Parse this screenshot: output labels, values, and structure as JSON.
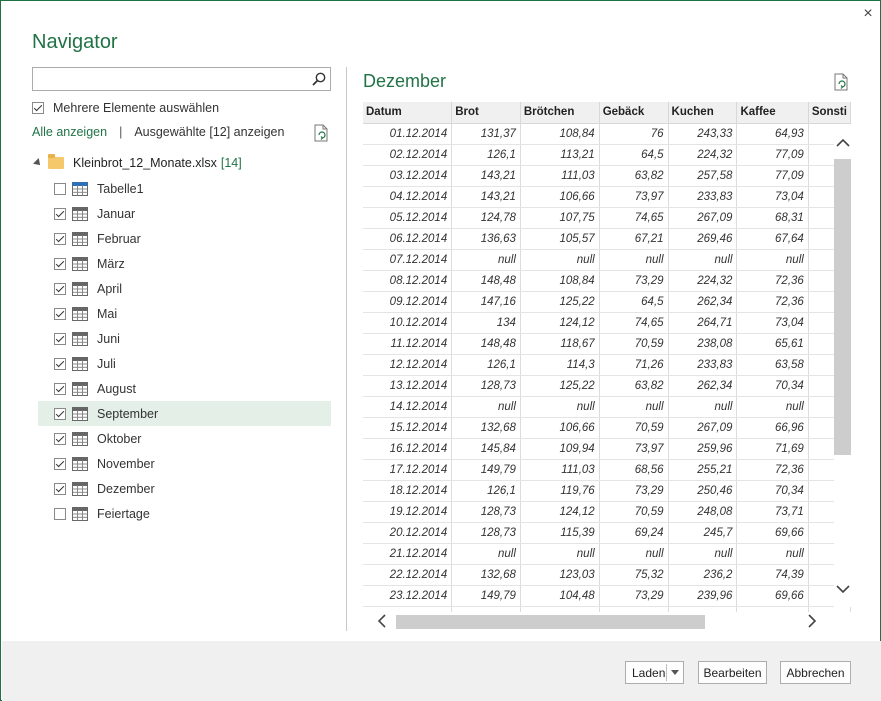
{
  "window": {
    "title": "Navigator",
    "close_glyph": "×"
  },
  "left": {
    "search_placeholder": "",
    "multi_select_label": "Mehrere Elemente auswählen",
    "multi_select_checked": true,
    "show_all": "Alle anzeigen",
    "separator": "|",
    "show_selected": "Ausgewählte [12] anzeigen",
    "root": {
      "label": "Kleinbrot_12_Monate.xlsx",
      "count": "[14]"
    },
    "items": [
      {
        "label": "Tabelle1",
        "checked": false,
        "icon": "table-icon"
      },
      {
        "label": "Januar",
        "checked": true,
        "icon": "sheet-icon"
      },
      {
        "label": "Februar",
        "checked": true,
        "icon": "sheet-icon"
      },
      {
        "label": "März",
        "checked": true,
        "icon": "sheet-icon"
      },
      {
        "label": "April",
        "checked": true,
        "icon": "sheet-icon"
      },
      {
        "label": "Mai",
        "checked": true,
        "icon": "sheet-icon"
      },
      {
        "label": "Juni",
        "checked": true,
        "icon": "sheet-icon"
      },
      {
        "label": "Juli",
        "checked": true,
        "icon": "sheet-icon"
      },
      {
        "label": "August",
        "checked": true,
        "icon": "sheet-icon"
      },
      {
        "label": "September",
        "checked": true,
        "icon": "sheet-icon",
        "selected": true
      },
      {
        "label": "Oktober",
        "checked": true,
        "icon": "sheet-icon"
      },
      {
        "label": "November",
        "checked": true,
        "icon": "sheet-icon"
      },
      {
        "label": "Dezember",
        "checked": true,
        "icon": "sheet-icon"
      },
      {
        "label": "Feiertage",
        "checked": false,
        "icon": "sheet-icon"
      }
    ]
  },
  "preview": {
    "title": "Dezember",
    "columns": [
      "Datum",
      "Brot",
      "Brötchen",
      "Gebäck",
      "Kuchen",
      "Kaffee",
      "Sonsti"
    ],
    "rows": [
      [
        "01.12.2014",
        "131,37",
        "108,84",
        "76",
        "243,33",
        "64,93",
        ""
      ],
      [
        "02.12.2014",
        "126,1",
        "113,21",
        "64,5",
        "224,32",
        "77,09",
        ""
      ],
      [
        "03.12.2014",
        "143,21",
        "111,03",
        "63,82",
        "257,58",
        "77,09",
        ""
      ],
      [
        "04.12.2014",
        "143,21",
        "106,66",
        "73,97",
        "233,83",
        "73,04",
        ""
      ],
      [
        "05.12.2014",
        "124,78",
        "107,75",
        "74,65",
        "267,09",
        "68,31",
        ""
      ],
      [
        "06.12.2014",
        "136,63",
        "105,57",
        "67,21",
        "269,46",
        "67,64",
        ""
      ],
      [
        "07.12.2014",
        "null",
        "null",
        "null",
        "null",
        "null",
        ""
      ],
      [
        "08.12.2014",
        "148,48",
        "108,84",
        "73,29",
        "224,32",
        "72,36",
        ""
      ],
      [
        "09.12.2014",
        "147,16",
        "125,22",
        "64,5",
        "262,34",
        "72,36",
        ""
      ],
      [
        "10.12.2014",
        "134",
        "124,12",
        "74,65",
        "264,71",
        "73,04",
        ""
      ],
      [
        "11.12.2014",
        "148,48",
        "118,67",
        "70,59",
        "238,08",
        "65,61",
        ""
      ],
      [
        "12.12.2014",
        "126,1",
        "114,3",
        "71,26",
        "233,83",
        "63,58",
        ""
      ],
      [
        "13.12.2014",
        "128,73",
        "125,22",
        "63,82",
        "262,34",
        "70,34",
        ""
      ],
      [
        "14.12.2014",
        "null",
        "null",
        "null",
        "null",
        "null",
        ""
      ],
      [
        "15.12.2014",
        "132,68",
        "106,66",
        "70,59",
        "267,09",
        "66,96",
        ""
      ],
      [
        "16.12.2014",
        "145,84",
        "109,94",
        "73,97",
        "259,96",
        "71,69",
        ""
      ],
      [
        "17.12.2014",
        "149,79",
        "111,03",
        "68,56",
        "255,21",
        "72,36",
        ""
      ],
      [
        "18.12.2014",
        "126,1",
        "119,76",
        "73,29",
        "250,46",
        "70,34",
        ""
      ],
      [
        "19.12.2014",
        "128,73",
        "124,12",
        "70,59",
        "248,08",
        "73,71",
        ""
      ],
      [
        "20.12.2014",
        "128,73",
        "115,39",
        "69,24",
        "245,7",
        "69,66",
        ""
      ],
      [
        "21.12.2014",
        "null",
        "null",
        "null",
        "null",
        "null",
        ""
      ],
      [
        "22.12.2014",
        "132,68",
        "123,03",
        "75,32",
        "236,2",
        "74,39",
        ""
      ],
      [
        "23.12.2014",
        "149,79",
        "104,48",
        "73,29",
        "239,96",
        "69,66",
        ""
      ],
      [
        "",
        "",
        "",
        "",
        "",
        "",
        ""
      ]
    ]
  },
  "footer": {
    "load_label": "Laden",
    "edit_label": "Bearbeiten",
    "cancel_label": "Abbrechen"
  },
  "colors": {
    "accent": "#217346",
    "selection": "#e3efe7",
    "footer_bg": "#f0f0f0"
  }
}
